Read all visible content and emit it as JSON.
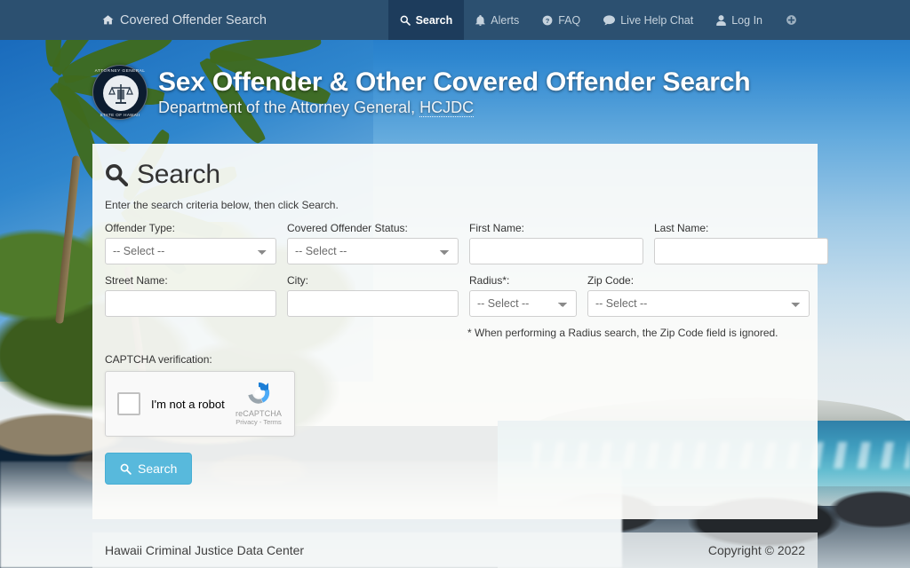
{
  "navbar": {
    "brand_label": "Covered Offender Search",
    "brand_icon": "home-icon",
    "items": [
      {
        "label": "Search",
        "icon": "search-icon",
        "active": true
      },
      {
        "label": "Alerts",
        "icon": "bell-icon",
        "active": false
      },
      {
        "label": "FAQ",
        "icon": "question-circle-icon",
        "active": false
      },
      {
        "label": "Live Help Chat",
        "icon": "chat-bubble-icon",
        "active": false
      },
      {
        "label": "Log In",
        "icon": "user-icon",
        "active": false
      },
      {
        "label": "",
        "icon": "accessibility-plus-icon",
        "active": false
      }
    ],
    "background_color": "#2c5070",
    "active_background_color": "#1d3c5c"
  },
  "header": {
    "seal_top_text": "ATTORNEY GENERAL",
    "seal_bottom_text": "STATE OF HAWAII",
    "seal_icon": "state-seal-scales-of-justice",
    "title": "Sex Offender & Other Covered Offender Search",
    "subtitle_prefix": "Department of the Attorney General, ",
    "subtitle_abbr": "HCJDC"
  },
  "panel": {
    "heading": "Search",
    "heading_icon": "search-icon",
    "instruction": "Enter the search criteria below, then click Search.",
    "fields": {
      "offender_type": {
        "label": "Offender Type:",
        "value": "-- Select --",
        "type": "select"
      },
      "covered_offender_status": {
        "label": "Covered Offender Status:",
        "value": "-- Select --",
        "type": "select"
      },
      "first_name": {
        "label": "First Name:",
        "value": "",
        "placeholder": "",
        "type": "text"
      },
      "last_name": {
        "label": "Last Name:",
        "value": "",
        "placeholder": "",
        "type": "text"
      },
      "street_name": {
        "label": "Street Name:",
        "value": "",
        "placeholder": "",
        "type": "text"
      },
      "city": {
        "label": "City:",
        "value": "",
        "placeholder": "",
        "type": "text"
      },
      "radius": {
        "label": "Radius*:",
        "value": "-- Select --",
        "type": "select"
      },
      "zip_code": {
        "label": "Zip Code:",
        "value": "-- Select --",
        "type": "select"
      }
    },
    "radius_note": "* When performing a Radius search, the Zip Code field is ignored.",
    "captcha": {
      "label": "CAPTCHA verification:",
      "checkbox_text": "I'm not a robot",
      "brand": "reCAPTCHA",
      "legal": "Privacy - Terms",
      "logo_icon": "recaptcha-logo-icon",
      "checked": false
    },
    "search_button": {
      "label": "Search",
      "icon": "search-icon",
      "color": "#58b9dc"
    }
  },
  "footer": {
    "left_text": "Hawaii Criminal Justice Data Center",
    "right_text": "Copyright © 2022"
  }
}
